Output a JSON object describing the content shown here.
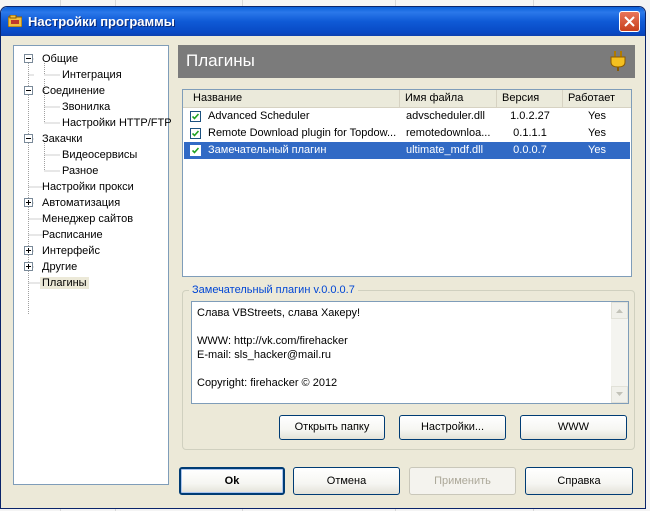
{
  "window": {
    "title": "Настройки программы"
  },
  "tree": {
    "items": [
      {
        "label": "Общие"
      },
      {
        "label": "Интеграция"
      },
      {
        "label": "Соединение"
      },
      {
        "label": "Звонилка"
      },
      {
        "label": "Настройки HTTP/FTP"
      },
      {
        "label": "Закачки"
      },
      {
        "label": "Видеосервисы"
      },
      {
        "label": "Разное"
      },
      {
        "label": "Настройки прокси"
      },
      {
        "label": "Автоматизация"
      },
      {
        "label": "Менеджер сайтов"
      },
      {
        "label": "Расписание"
      },
      {
        "label": "Интерфейс"
      },
      {
        "label": "Другие"
      },
      {
        "label": "Плагины"
      }
    ]
  },
  "panel": {
    "title": "Плагины"
  },
  "table": {
    "columns": [
      "Название",
      "Имя файла",
      "Версия",
      "Работает"
    ],
    "rows": [
      {
        "name": "Advanced Scheduler",
        "file": "advscheduler.dll",
        "version": "1.0.2.27",
        "works": "Yes",
        "checked": true
      },
      {
        "name": "Remote Download plugin for Topdow...",
        "file": "remotedownloa...",
        "version": "0.1.1.1",
        "works": "Yes",
        "checked": true
      },
      {
        "name": "Замечательный плагин",
        "file": "ultimate_mdf.dll",
        "version": "0.0.0.7",
        "works": "Yes",
        "checked": true,
        "selected": true
      }
    ]
  },
  "details": {
    "title": "Замечательный плагин v.0.0.0.7",
    "lines": [
      "Слава VBStreets, слава Хакеру!",
      "",
      "WWW: http://vk.com/firehacker",
      "E-mail: sls_hacker@mail.ru",
      "",
      "Copyright: firehacker © 2012"
    ]
  },
  "buttons": {
    "open_folder": "Открыть папку",
    "settings": "Настройки...",
    "www": "WWW",
    "ok": "Ok",
    "cancel": "Отмена",
    "apply": "Применить",
    "help": "Справка"
  },
  "colors": {
    "title_bar": "#0a5fd9",
    "selection": "#316ac5",
    "header": "#7b7b7b",
    "group_title": "#0046d5"
  }
}
